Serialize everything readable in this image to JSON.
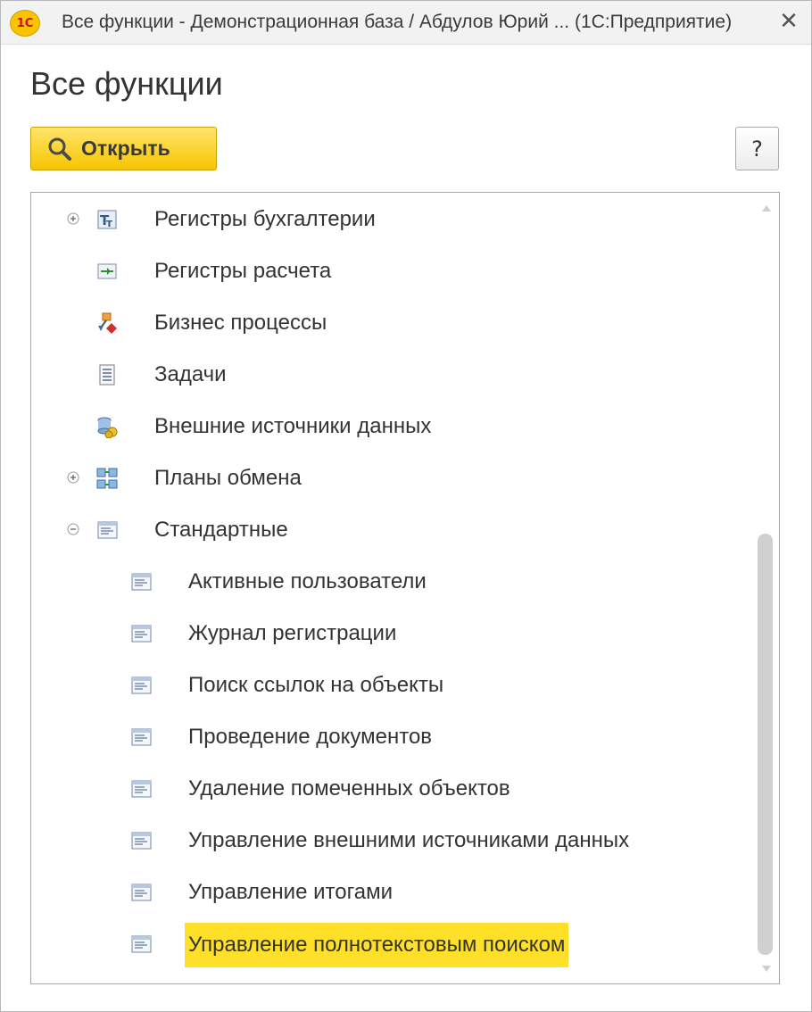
{
  "window": {
    "title": "Все функции - Демонстрационная база / Абдулов Юрий ...  (1С:Предприятие)",
    "logo_text": "1С",
    "close_glyph": "✕"
  },
  "page": {
    "title": "Все функции"
  },
  "toolbar": {
    "open_label": "Открыть",
    "open_icon": "magnifier-icon",
    "help_label": "?"
  },
  "tree": {
    "items": [
      {
        "label": "Регистры бухгалтерии",
        "icon": "accounting-register-icon",
        "toggle": "plus",
        "level": 0
      },
      {
        "label": "Регистры расчета",
        "icon": "calculation-register-icon",
        "toggle": "",
        "level": 0
      },
      {
        "label": "Бизнес процессы",
        "icon": "business-process-icon",
        "toggle": "",
        "level": 0
      },
      {
        "label": "Задачи",
        "icon": "task-icon",
        "toggle": "",
        "level": 0
      },
      {
        "label": "Внешние источники данных",
        "icon": "external-data-source-icon",
        "toggle": "",
        "level": 0
      },
      {
        "label": "Планы обмена",
        "icon": "exchange-plan-icon",
        "toggle": "plus",
        "level": 0
      },
      {
        "label": "Стандартные",
        "icon": "processing-icon",
        "toggle": "minus",
        "level": 0
      },
      {
        "label": "Активные пользователи",
        "icon": "processing-icon",
        "toggle": "",
        "level": 1
      },
      {
        "label": "Журнал регистрации",
        "icon": "processing-icon",
        "toggle": "",
        "level": 1
      },
      {
        "label": "Поиск ссылок на объекты",
        "icon": "processing-icon",
        "toggle": "",
        "level": 1
      },
      {
        "label": "Проведение документов",
        "icon": "processing-icon",
        "toggle": "",
        "level": 1
      },
      {
        "label": "Удаление помеченных объектов",
        "icon": "processing-icon",
        "toggle": "",
        "level": 1
      },
      {
        "label": "Управление внешними источниками данных",
        "icon": "processing-icon",
        "toggle": "",
        "level": 1
      },
      {
        "label": "Управление итогами",
        "icon": "processing-icon",
        "toggle": "",
        "level": 1
      },
      {
        "label": "Управление полнотекстовым поиском",
        "icon": "processing-icon",
        "toggle": "",
        "level": 1,
        "highlighted": true
      }
    ]
  },
  "colors": {
    "accent_yellow": "#f6c500",
    "highlight": "#ffe028",
    "text": "#333333"
  }
}
